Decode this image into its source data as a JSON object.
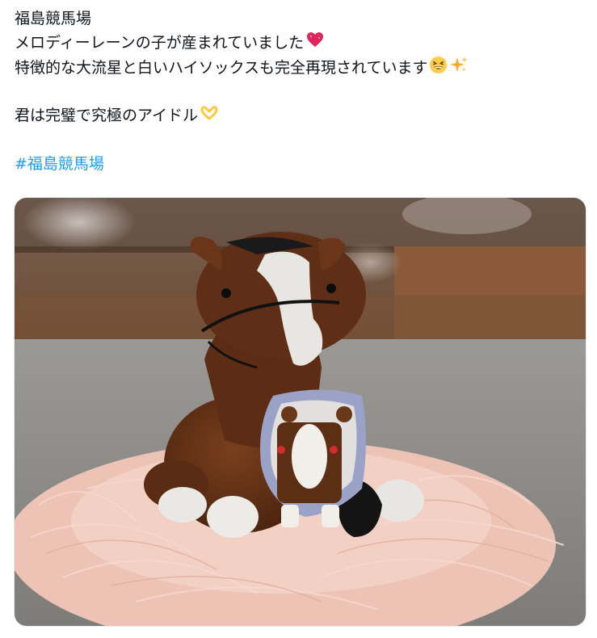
{
  "post": {
    "line1": "福島競馬場",
    "line2": "メロディーレーンの子が産まれていました",
    "line2_emoji": "sparkling-heart",
    "line3": "特徴的な大流星と白いハイソックスも完全再現されています",
    "line3_emojis": [
      "grinning-squinting-face",
      "sparkles"
    ],
    "line4": "君は完璧で究極のアイドル",
    "line4_emoji": "heart-hands",
    "hashtag": "#福島競馬場"
  },
  "media": {
    "kind": "photo",
    "subject": "plush-horse-with-knitted-foal-doll",
    "colors": {
      "horse_body": "#5e2f16",
      "blaze": "#e8e6e2",
      "shredded_paper": "#f0c9bd",
      "background_cabinet": "#6b4a34",
      "table": "#8e8e8b"
    }
  },
  "colors": {
    "text": "#0f1419",
    "link": "#1d9bf0",
    "border": "#e6e9ec"
  }
}
